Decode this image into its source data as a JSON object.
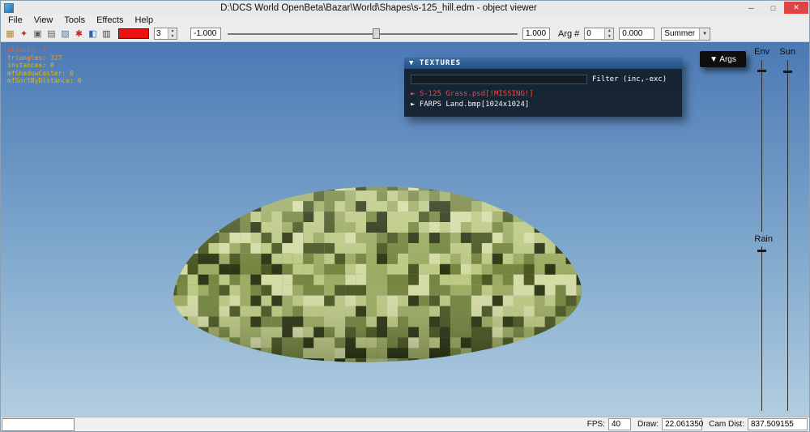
{
  "window": {
    "title": "D:\\DCS World OpenBeta\\Bazar\\World\\Shapes\\s-125_hill.edm - object viewer",
    "controls": {
      "minimize": "─",
      "maximize": "□",
      "close": "✕",
      "close_bg": "#e04343"
    }
  },
  "menu": {
    "items": [
      "File",
      "View",
      "Tools",
      "Effects",
      "Help"
    ]
  },
  "toolbar": {
    "icons": [
      {
        "name": "open-model-icon",
        "glyph": "▦",
        "color": "#b08830"
      },
      {
        "name": "animation-icon",
        "glyph": "✦",
        "color": "#cc2222"
      },
      {
        "name": "screenshot-icon",
        "glyph": "▣",
        "color": "#606060"
      },
      {
        "name": "grid-icon",
        "glyph": "▤",
        "color": "#606060"
      },
      {
        "name": "texture-icon",
        "glyph": "▨",
        "color": "#557799"
      },
      {
        "name": "effects-icon",
        "glyph": "✱",
        "color": "#cc2222"
      },
      {
        "name": "display-icon",
        "glyph": "◧",
        "color": "#3366aa"
      },
      {
        "name": "camera-icon",
        "glyph": "▥",
        "color": "#404040"
      }
    ],
    "swatch_color": "#ee1111",
    "speed_value": "3",
    "anim_min": "-1.000",
    "anim_max": "1.000",
    "arg_label": "Arg #",
    "arg_number": "0",
    "arg_value": "0.000",
    "season": "Summer",
    "spinner_up": "▲",
    "spinner_down": "▼",
    "dropdown_arrow": "▼"
  },
  "debug_overlay": {
    "lines": [
      {
        "text": "objects: 1",
        "color": "#ff5a1e"
      },
      {
        "text": "triangles: 327",
        "color": "#ff9a1e"
      },
      {
        "text": "instances: 0",
        "color": "#e7b900"
      },
      {
        "text": "mfShadowCaster: 0",
        "color": "#e7b900"
      },
      {
        "text": "mfSortByDistance: 0",
        "color": "#e7b900"
      }
    ]
  },
  "textures_panel": {
    "title": "▼ TEXTURES",
    "filter_value": "",
    "filter_label": "Filter (inc,-exc)",
    "items": [
      {
        "text": "► S-125 Grass.psd[!MISSING!]",
        "color": "#ff4040"
      },
      {
        "text": "► FARPS Land.bmp[1024x1024]",
        "color": "#f5f5f5"
      }
    ]
  },
  "args_button": {
    "label": "▼ Args"
  },
  "env_panel": {
    "env_label": "Env",
    "sun_label": "Sun",
    "rain_label": "Rain"
  },
  "status_bar": {
    "left_value": "",
    "fps_label": "FPS:",
    "fps_value": "40",
    "draw_label": "Draw:",
    "draw_value": "22.061350",
    "cam_label": "Cam Dist:",
    "cam_value": "837.509155"
  },
  "viewport": {
    "sky_top": "#4b79b4",
    "sky_bottom": "#b2cde0",
    "camo_colors": [
      [
        "#bcc983",
        0.28
      ],
      [
        "#9cab62",
        0.2
      ],
      [
        "#74853f",
        0.16
      ],
      [
        "#4a5722",
        0.14
      ],
      [
        "#2b3513",
        0.11
      ],
      [
        "#d4dba4",
        0.11
      ]
    ]
  }
}
